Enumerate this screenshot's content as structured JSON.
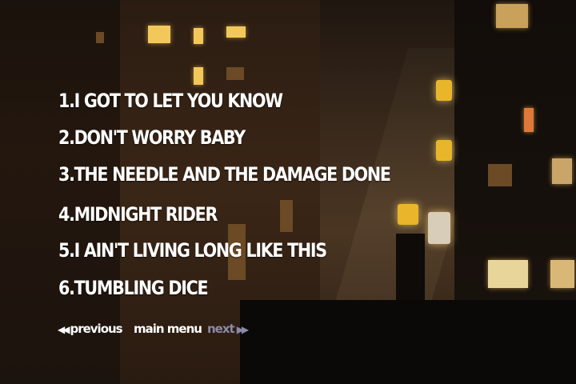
{
  "tracks": [
    {
      "number": "1.",
      "title": "I GOT TO LET YOU KNOW"
    },
    {
      "number": "2.",
      "title": "DON'T WORRY BABY"
    },
    {
      "number": "3.",
      "title": "THE NEEDLE AND THE DAMAGE DONE"
    },
    {
      "number": "4.",
      "title": "MIDNIGHT RIDER"
    },
    {
      "number": "5.",
      "title": "I AIN'T LIVING LONG LIKE THIS"
    },
    {
      "number": "6.",
      "title": "TUMBLING DICE"
    }
  ],
  "nav": {
    "previous_label": "previous",
    "main_menu_label": "main menu",
    "next_label": "next",
    "previous_icon": "double-left-arrow-icon",
    "next_icon": "double-right-arrow-icon"
  },
  "colors": {
    "text": "#ffffff",
    "disabled": "#8a8aa8"
  }
}
